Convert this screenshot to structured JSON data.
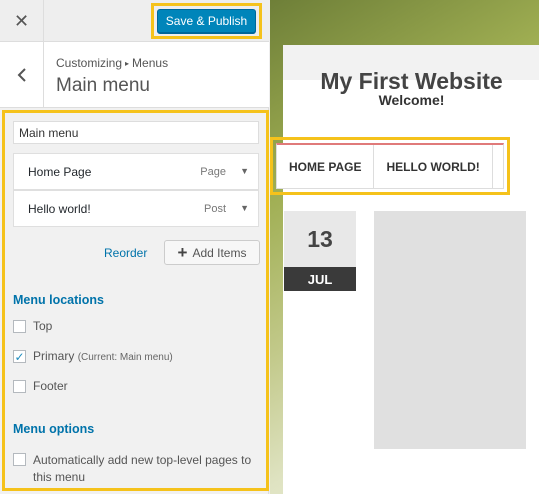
{
  "toolbar": {
    "close_icon": "close-icon",
    "publish_label": "Save & Publish",
    "accent": "#0085ba",
    "highlight": "#f5c21b"
  },
  "section": {
    "back_icon": "chevron-left-icon",
    "breadcrumb_parent": "Customizing",
    "breadcrumb_sep": "▸",
    "breadcrumb_current": "Menus",
    "title": "Main menu"
  },
  "menu": {
    "name_value": "Main menu",
    "items": [
      {
        "title": "Home Page",
        "type": "Page"
      },
      {
        "title": "Hello world!",
        "type": "Post"
      }
    ],
    "reorder_label": "Reorder",
    "add_items_label": "Add Items"
  },
  "locations": {
    "heading": "Menu locations",
    "items": [
      {
        "label": "Top",
        "note": "",
        "checked": false
      },
      {
        "label": "Primary",
        "note": "(Current: Main menu)",
        "checked": true
      },
      {
        "label": "Footer",
        "note": "",
        "checked": false
      }
    ]
  },
  "options": {
    "heading": "Menu options",
    "auto_add_label": "Automatically add new top-level pages to this menu",
    "auto_add_checked": false
  },
  "preview": {
    "site_title": "My First Website",
    "tagline": "Welcome!",
    "nav": [
      "HOME PAGE",
      "HELLO WORLD!"
    ],
    "date_day": "13",
    "date_month": "JUL"
  }
}
